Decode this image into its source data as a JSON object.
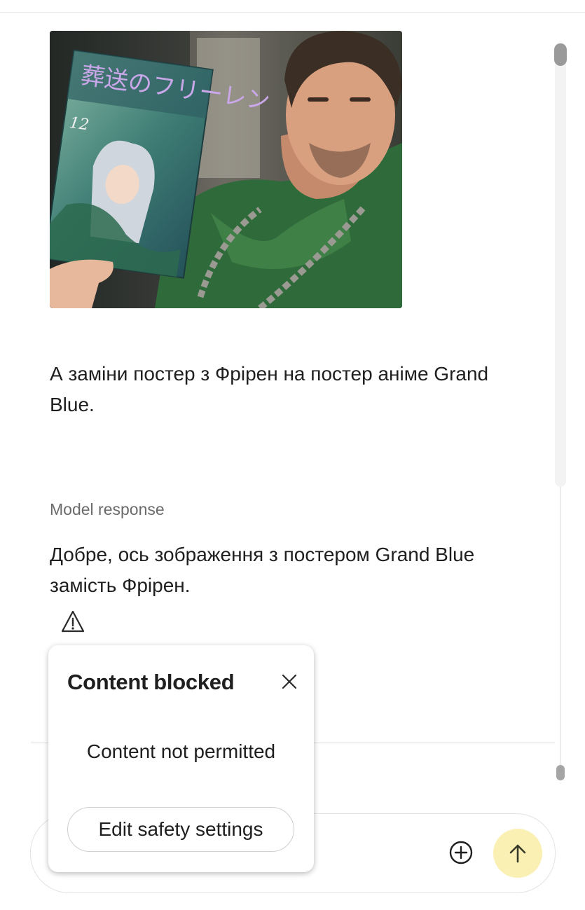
{
  "chat": {
    "user_prompt": "А заміни постер з Фрірен на постер аніме Grand Blue.",
    "model_label": "Model response",
    "model_text": "Добре, ось зображення з постером Grand Blue замість Фрірен.",
    "attachment_icon": "warning-icon"
  },
  "attachment": {
    "manga_title": "葬送のフリーレン",
    "manga_volume": "12"
  },
  "popup": {
    "title": "Content blocked",
    "message": "Content not permitted",
    "button_label": "Edit safety settings"
  },
  "input": {
    "add_icon": "add-circle-icon",
    "send_icon": "send-arrow-icon",
    "send_color": "#fbf0b4"
  }
}
